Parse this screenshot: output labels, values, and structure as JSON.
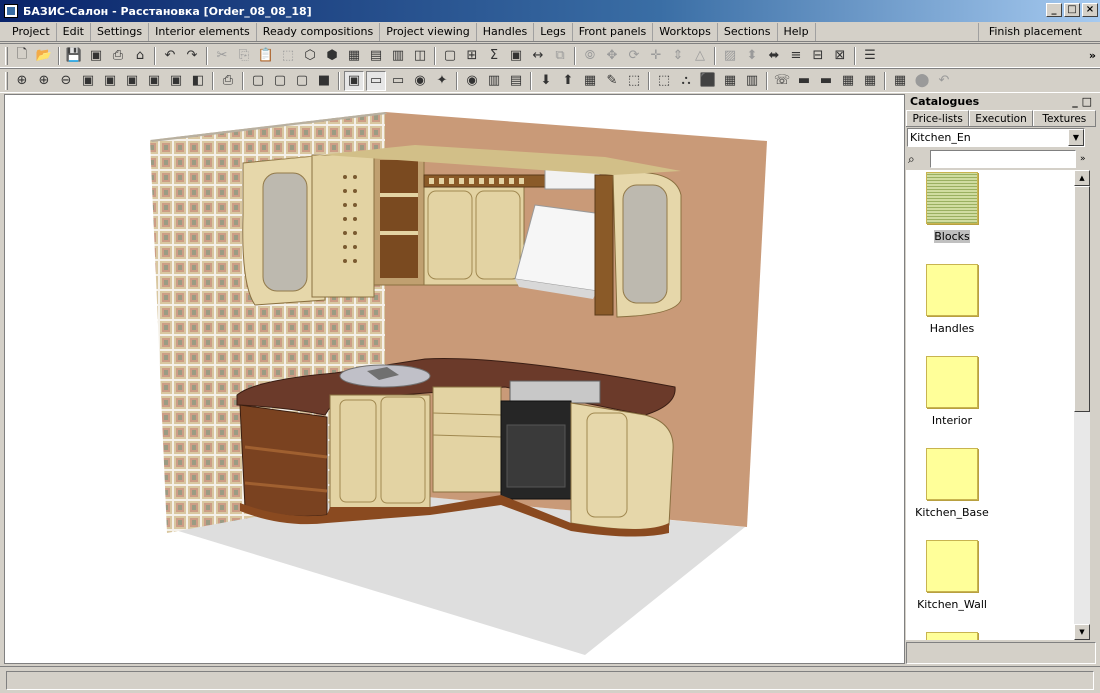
{
  "window": {
    "title": "БАЗИС-Салон - Расстановка [Order_08_08_18]",
    "controls": [
      "_",
      "□",
      "×"
    ]
  },
  "menu": {
    "items": [
      "Project",
      "Edit",
      "Settings",
      "Interior elements",
      "Ready compositions",
      "Project viewing",
      "Handles",
      "Legs",
      "Front panels",
      "Worktops",
      "Sections",
      "Help"
    ],
    "finish_label": "Finish placement"
  },
  "toolbar1": [
    {
      "icon": "new-doc-icon",
      "g": "🗋"
    },
    {
      "icon": "open-icon",
      "g": "📂"
    },
    {
      "icon": "save-icon",
      "g": "💾"
    },
    {
      "icon": "save-as-icon",
      "g": "▣"
    },
    {
      "icon": "print-icon",
      "g": "⎙"
    },
    {
      "icon": "home-icon",
      "g": "⌂"
    },
    {
      "icon": "undo-icon",
      "g": "↶"
    },
    {
      "icon": "redo-icon",
      "g": "↷"
    },
    {
      "icon": "cut-icon",
      "g": "✂"
    },
    {
      "icon": "copy-icon",
      "g": "⎘"
    },
    {
      "icon": "paste-icon",
      "g": "📋"
    },
    {
      "icon": "select-icon",
      "g": "⬚"
    }
  ],
  "toolbar2_count": 40,
  "catalogues": {
    "header": "Catalogues",
    "header_controls": "_ □",
    "tabs": [
      "Price-lists",
      "Execution",
      "Textures"
    ],
    "selected_catalogue": "Kitchen_En",
    "search_placeholder": "",
    "items": [
      {
        "label": "Blocks",
        "selected": true
      },
      {
        "label": "Handles"
      },
      {
        "label": "Interior"
      },
      {
        "label": "Kitchen_Base"
      },
      {
        "label": "Kitchen_Wall"
      }
    ]
  },
  "colors": {
    "accent_title": "#0a246a",
    "folder": "#ffff99",
    "wall_right": "#c99a78",
    "floor": "#dcdcdc",
    "worktop": "#6b3a2a",
    "cabinet": "#e2d3a4"
  }
}
